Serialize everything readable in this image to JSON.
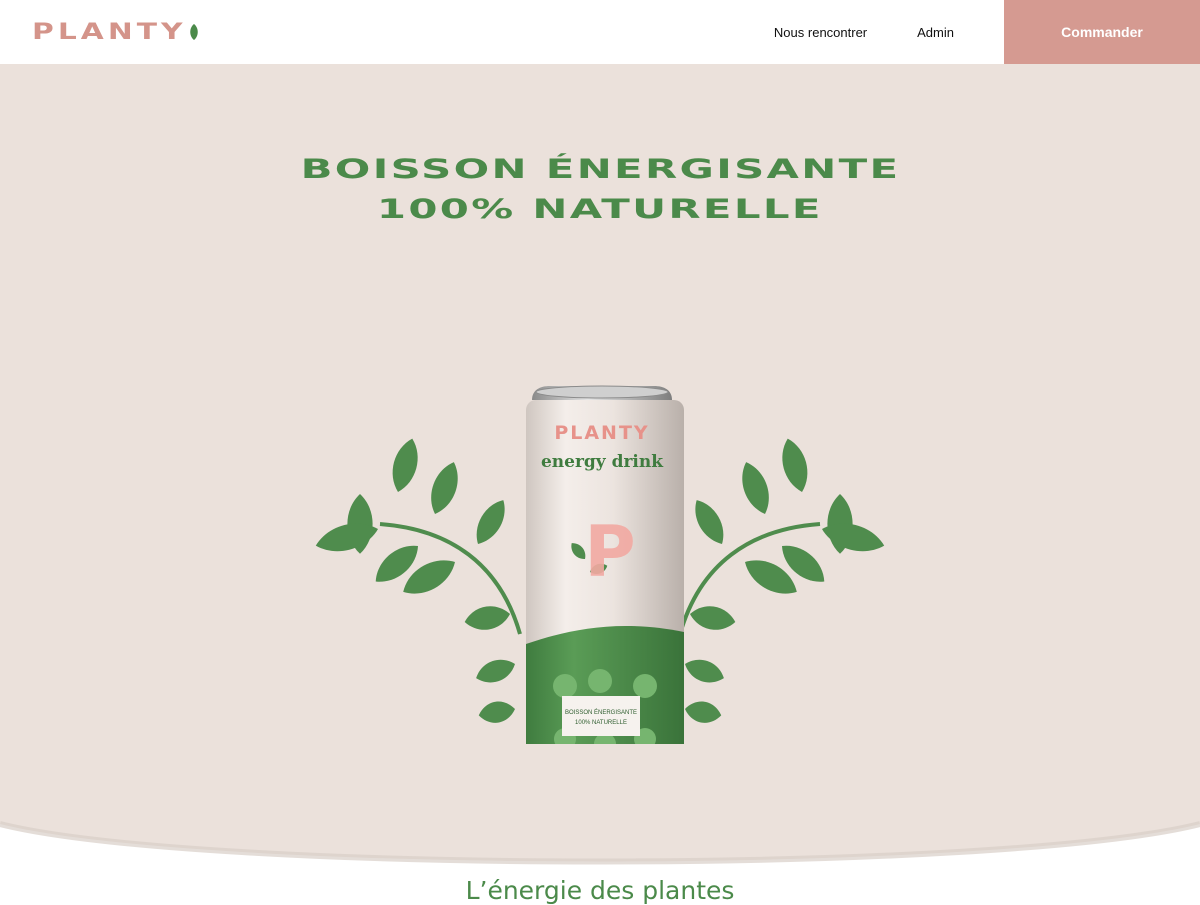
{
  "header": {
    "logo_text": "PLANTY",
    "nav": [
      {
        "label": "Nous rencontrer"
      },
      {
        "label": "Admin"
      }
    ],
    "cta_label": "Commander"
  },
  "hero": {
    "title_line1": "BOISSON ÉNERGISANTE",
    "title_line2": "100% NATURELLE",
    "can": {
      "brand": "PLANTY",
      "subtitle": "energy drink",
      "monogram": "P",
      "label_line1": "BOISSON ÉNERGISANTE",
      "label_line2": "100% NATURELLE"
    }
  },
  "section": {
    "title": "L’énergie des plantes"
  },
  "colors": {
    "brand_pink": "#d59a91",
    "brand_green": "#4b8a4a",
    "hero_bg": "#ebe1db"
  },
  "icons": {
    "logo_leaf": "leaf-icon"
  }
}
